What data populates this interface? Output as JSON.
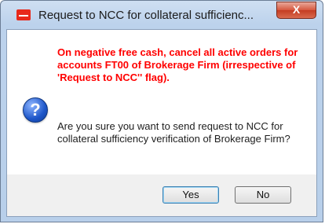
{
  "window": {
    "title": "Request to NCC for collateral sufficienc...",
    "close_label": "X"
  },
  "dialog": {
    "icon": "question-icon",
    "warning_text": "On negative free cash, cancel all active orders for accounts FT00 of Brokerage Firm (irrespective of 'Request to NCC'' flag).",
    "question_text": "Are you sure you want to send request to NCC for collateral sufficiency verification of Brokerage Firm?",
    "warning_color": "#ff0000"
  },
  "buttons": {
    "yes_label": "Yes",
    "no_label": "No"
  }
}
